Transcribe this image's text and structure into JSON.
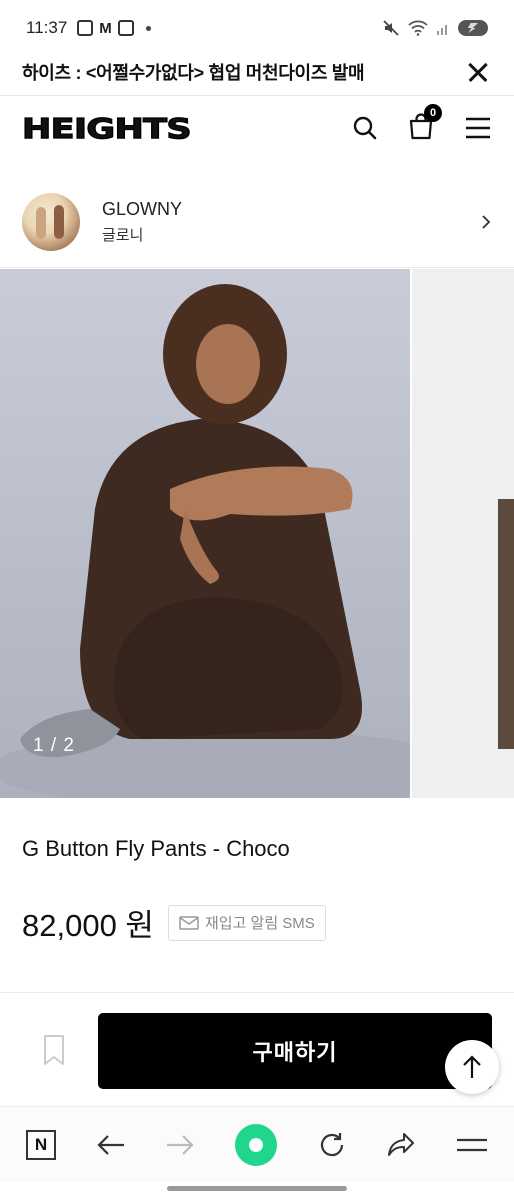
{
  "status_bar": {
    "time": "11:37"
  },
  "webview": {
    "title": "하이츠 : <어쩔수가없다> 협업 머천다이즈 발매"
  },
  "site": {
    "logo": "HEIGHTS",
    "cart_count": "0"
  },
  "brand": {
    "name": "GLOWNY",
    "name_kr": "글로니"
  },
  "gallery": {
    "page_indicator": "1 / 2"
  },
  "product": {
    "title": "G Button Fly Pants - Choco",
    "price": "82,000 원",
    "restock_label": "재입고 알림 SMS"
  },
  "actions": {
    "buy_label": "구매하기"
  },
  "colors": {
    "accent_green": "#1fd68c",
    "buy_button": "#000000"
  },
  "browser_nav": {
    "icons": [
      "naver-n-icon",
      "back-arrow-icon",
      "forward-arrow-icon",
      "home-icon",
      "refresh-icon",
      "share-icon",
      "menu-icon"
    ],
    "n_label": "N"
  }
}
